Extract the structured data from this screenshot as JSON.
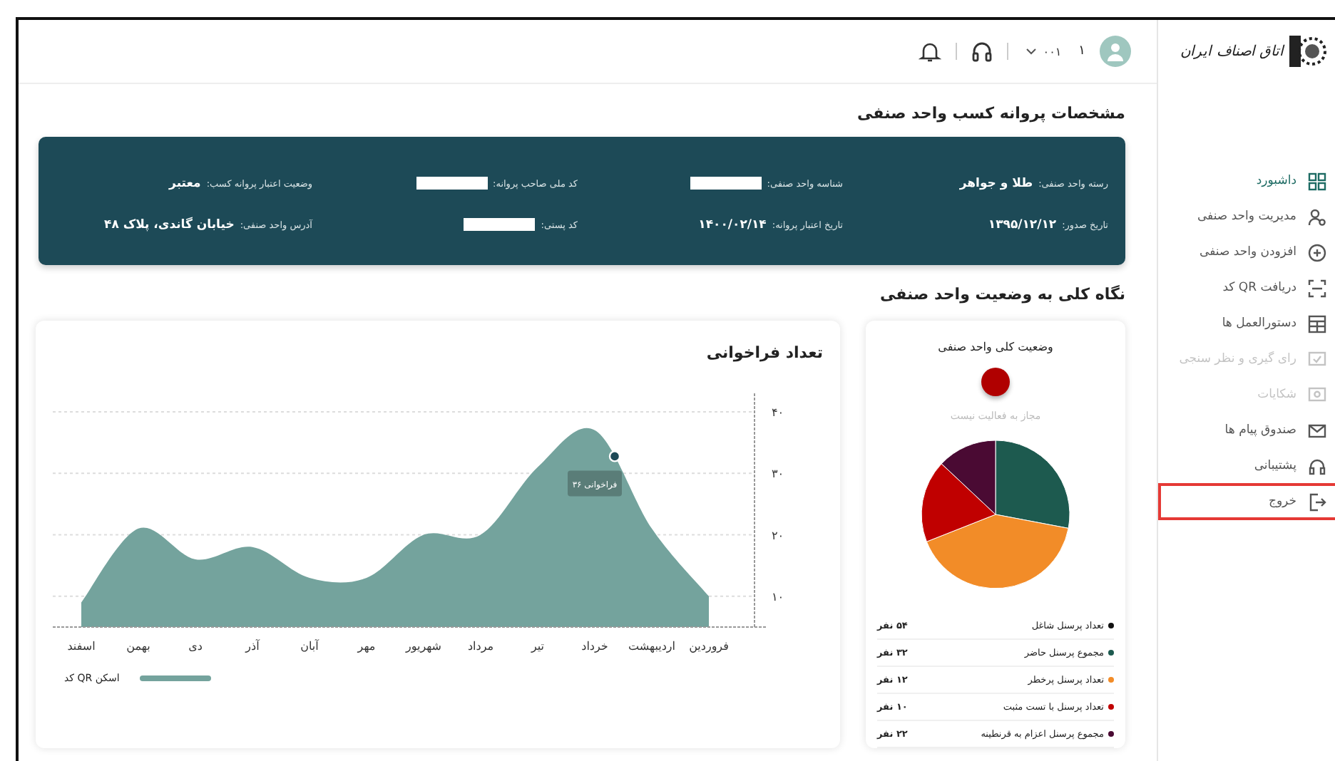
{
  "sidebar": {
    "logo_text": "اتاق اصناف ایران",
    "items": [
      {
        "label": "داشبورد",
        "selected": true,
        "disabled": false,
        "highlighted": false
      },
      {
        "label": "مدیریت واحد صنفی",
        "selected": false,
        "disabled": false,
        "highlighted": false
      },
      {
        "label": "افزودن واحد صنفی",
        "selected": false,
        "disabled": false,
        "highlighted": false
      },
      {
        "label": "دریافت QR کد",
        "selected": false,
        "disabled": false,
        "highlighted": false
      },
      {
        "label": "دستورالعمل ها",
        "selected": false,
        "disabled": false,
        "highlighted": false
      },
      {
        "label": "رای گیری و نظر سنجی",
        "selected": false,
        "disabled": true,
        "highlighted": false
      },
      {
        "label": "شکایات",
        "selected": false,
        "disabled": true,
        "highlighted": false
      },
      {
        "label": "صندوق پیام ها",
        "selected": false,
        "disabled": false,
        "highlighted": false
      },
      {
        "label": "پشتیبانی",
        "selected": false,
        "disabled": false,
        "highlighted": false
      },
      {
        "label": "خروج",
        "selected": false,
        "disabled": false,
        "highlighted": true
      }
    ]
  },
  "header": {
    "user_number": "۱",
    "account": "۰۰۱"
  },
  "page_title": "مشخصات پروانه کسب واحد صنفی",
  "license_fields": [
    {
      "label": "رسته واحد صنفی:",
      "value": "طلا و جواهر",
      "redacted": false
    },
    {
      "label": "شناسه واحد صنفی:",
      "redacted": true
    },
    {
      "label": "کد ملی صاحب پروانه:",
      "redacted": true
    },
    {
      "label": "وضعیت اعتبار پروانه کسب:",
      "value": "معتبر",
      "redacted": false
    },
    {
      "label": "تاریخ صدور:",
      "value": "۱۳۹۵/۱۲/۱۲",
      "redacted": false
    },
    {
      "label": "تاریخ اعتبار پروانه:",
      "value": "۱۴۰۰/۰۲/۱۴",
      "redacted": false
    },
    {
      "label": "کد پستی:",
      "redacted": true
    },
    {
      "label": "آدرس واحد صنفی:",
      "value": "خیابان گاندی، پلاک ۴۸",
      "redacted": false
    }
  ],
  "overview_title": "نگاه کلی به وضعیت واحد صنفی",
  "status": {
    "title": "وضعیت کلی واحد صنفی",
    "color": "#b00000",
    "text": "مجاز به فعالیت نیست",
    "legend": [
      {
        "label": "تعداد پرسنل شاغل",
        "value": "۵۴ نفر",
        "color": "#111111"
      },
      {
        "label": "مجموع پرسنل حاضر",
        "value": "۳۲ نفر",
        "color": "#1d5a4f"
      },
      {
        "label": "تعداد پرسنل پرخطر",
        "value": "۱۲ نفر",
        "color": "#f28c28"
      },
      {
        "label": "تعداد پرسنل با تست مثبت",
        "value": "۱۰ نفر",
        "color": "#c00000"
      },
      {
        "label": "مجموع پرسنل اعزام به قرنطینه",
        "value": "۲۲ نفر",
        "color": "#4a0a33"
      }
    ]
  },
  "recalls": {
    "title": "تعداد فراخوانی",
    "chart_data": {
      "type": "area",
      "categories": [
        "اسفند",
        "بهمن",
        "دی",
        "آذر",
        "آبان",
        "مهر",
        "شهریور",
        "مرداد",
        "تیر",
        "خرداد",
        "اردیبهشت",
        "فروردین"
      ],
      "series": [
        {
          "name": "اسکن QR کد",
          "color": "#74a39d",
          "values": [
            9,
            21,
            16,
            18,
            13,
            13,
            20,
            20,
            31,
            37,
            21,
            10
          ]
        }
      ],
      "grid": true,
      "ylim": [
        5,
        43
      ],
      "yticks": [
        {
          "value": 10,
          "label": "۱۰"
        },
        {
          "value": 20,
          "label": "۲۰"
        },
        {
          "value": 30,
          "label": "۳۰"
        },
        {
          "value": 40,
          "label": "۴۰"
        }
      ],
      "annotations": [
        "۳۶ فراخوانی"
      ]
    }
  }
}
